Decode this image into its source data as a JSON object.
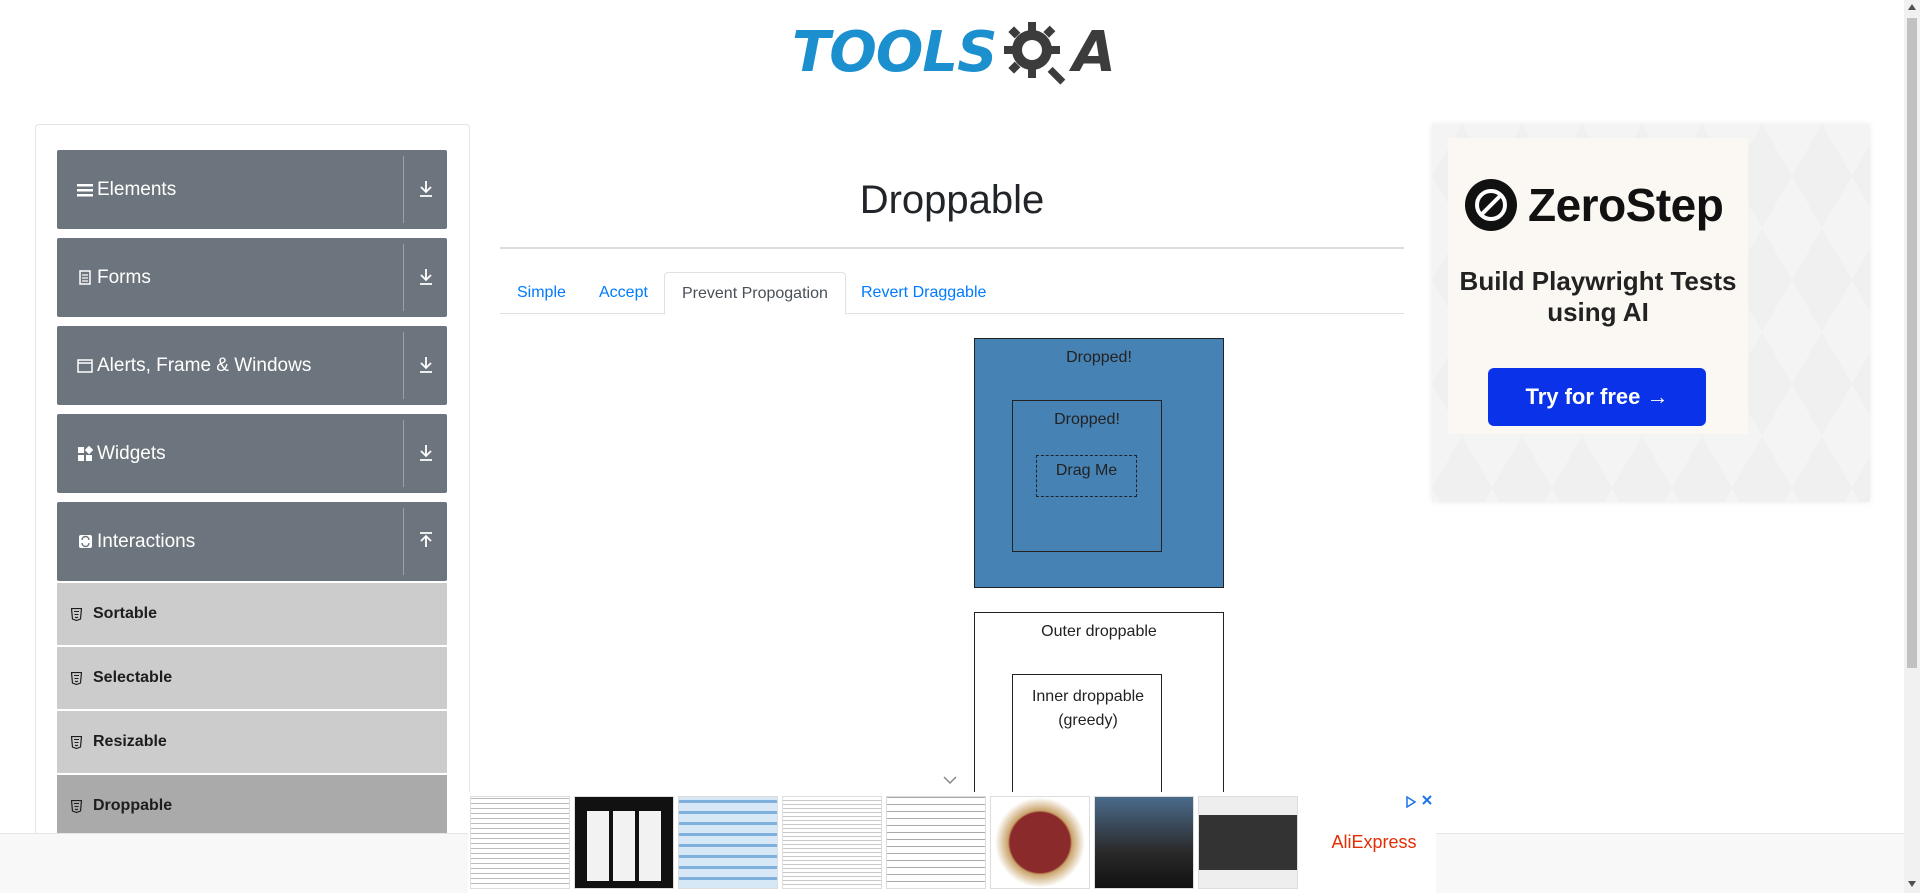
{
  "header": {
    "logo_text": "TOOLS",
    "logo_suffix": "A"
  },
  "sidebar": {
    "groups": [
      {
        "label": "Elements",
        "icon": "hamburger-icon",
        "expanded": false
      },
      {
        "label": "Forms",
        "icon": "document-icon",
        "expanded": false
      },
      {
        "label": "Alerts, Frame & Windows",
        "icon": "window-icon",
        "expanded": false
      },
      {
        "label": "Widgets",
        "icon": "widgets-icon",
        "expanded": false
      },
      {
        "label": "Interactions",
        "icon": "interactions-icon",
        "expanded": true
      }
    ],
    "items": [
      {
        "label": "Sortable"
      },
      {
        "label": "Selectable"
      },
      {
        "label": "Resizable"
      },
      {
        "label": "Droppable",
        "active": true
      }
    ]
  },
  "main": {
    "title": "Droppable",
    "tabs": [
      {
        "label": "Simple"
      },
      {
        "label": "Accept"
      },
      {
        "label": "Prevent Propogation",
        "active": true
      },
      {
        "label": "Revert Draggable"
      }
    ],
    "outer_droppable_label": "Dropped!",
    "inner_droppable_label": "Dropped!",
    "drag_label": "Drag Me",
    "outer2_label": "Outer droppable",
    "inner2_label": "Inner droppable (greedy)"
  },
  "ad": {
    "brand": "ZeroStep",
    "tagline": "Build Playwright Tests using AI",
    "button": "Try for free →"
  },
  "bottom_ad": {
    "brand": "AliExpress"
  },
  "colors": {
    "accent": "#007bff",
    "sidebar_header": "#6c757d",
    "sidebar_item": "#cccccc",
    "sidebar_item_active": "#aaaaaa",
    "dropped_fill": "#4682b4",
    "logo_blue": "#1c8fcf",
    "ad_button": "#0a32e8"
  }
}
